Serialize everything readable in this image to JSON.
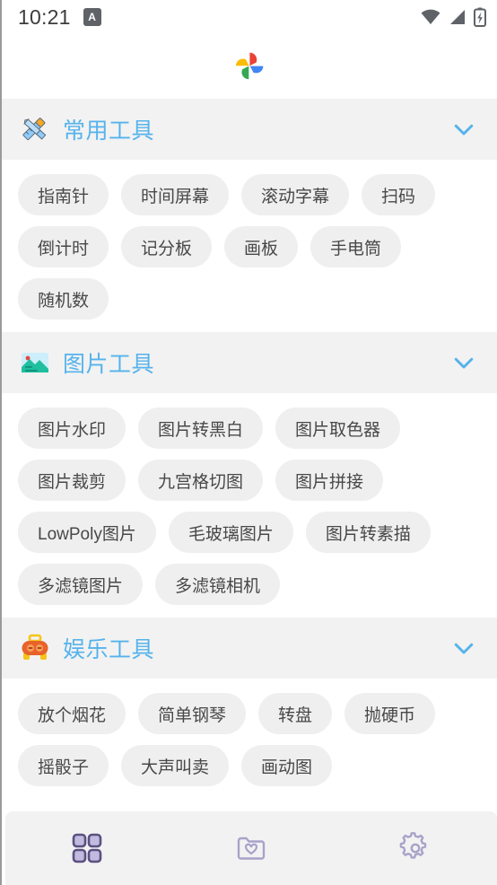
{
  "status_bar": {
    "time": "10:21",
    "app_badge_label": "A",
    "icons": [
      "wifi-icon",
      "cellular-signal-icon",
      "battery-charging-icon"
    ]
  },
  "header": {
    "logo_name": "google-photos-pinwheel-logo",
    "logo_colors": {
      "red": "#EA4335",
      "yellow": "#FBBC05",
      "green": "#34A853",
      "blue": "#4285F4"
    }
  },
  "theme": {
    "section_title_color": "#55B3EC",
    "section_header_bg": "#F2F2F2",
    "chip_bg": "#EFEFEF",
    "chip_text": "#484848",
    "nav_active_color": "#5B5180",
    "nav_inactive_color": "#A9A2C9"
  },
  "sections": [
    {
      "title": "常用工具",
      "icon": "pencil-ruler-emoji",
      "expanded": true,
      "chevron": "chevron-down-icon",
      "chips": [
        "指南针",
        "时间屏幕",
        "滚动字幕",
        "扫码",
        "倒计时",
        "记分板",
        "画板",
        "手电筒",
        "随机数"
      ]
    },
    {
      "title": "图片工具",
      "icon": "landscape-picture-emoji",
      "expanded": true,
      "chevron": "chevron-down-icon",
      "chips": [
        "图片水印",
        "图片转黑白",
        "图片取色器",
        "图片裁剪",
        "九宫格切图",
        "图片拼接",
        "LowPoly图片",
        "毛玻璃图片",
        "图片转素描",
        "多滤镜图片",
        "多滤镜相机"
      ]
    },
    {
      "title": "娱乐工具",
      "icon": "robot-toy-emoji",
      "expanded": true,
      "chevron": "chevron-down-icon",
      "chips": [
        "放个烟花",
        "简单钢琴",
        "转盘",
        "抛硬币",
        "摇骰子",
        "大声叫卖",
        "画动图"
      ]
    }
  ],
  "bottom_nav": {
    "items": [
      {
        "name": "tools-grid",
        "icon": "grid-icon",
        "active": true
      },
      {
        "name": "favorites-folder",
        "icon": "folder-heart-icon",
        "active": false
      },
      {
        "name": "settings",
        "icon": "gear-icon",
        "active": false
      }
    ]
  }
}
